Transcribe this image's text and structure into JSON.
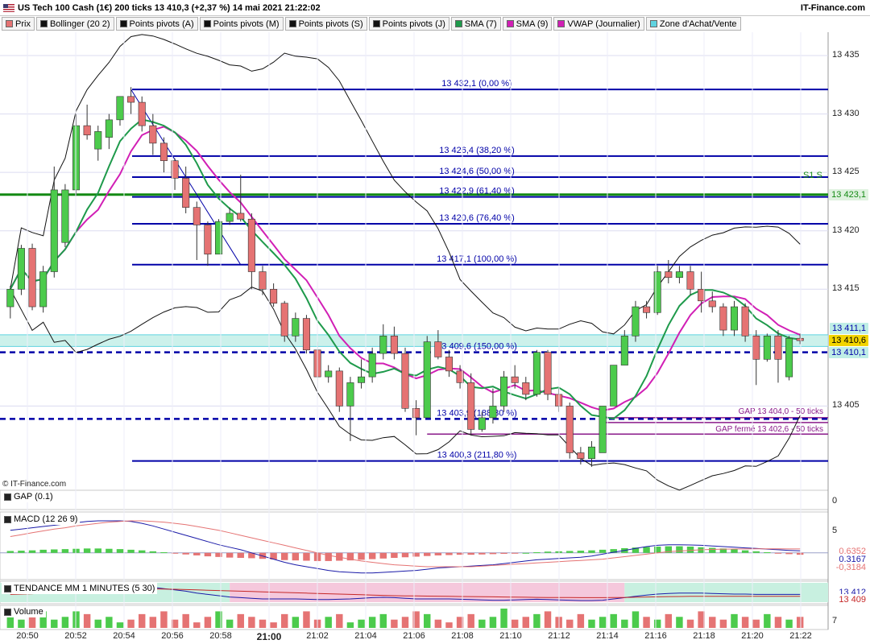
{
  "header": {
    "title": "US Tech 100 Cash (1€) 200 ticks 13 410,3 (+2,37 %) 14 mai 2021 21:22:02",
    "brand": "IT-Finance.com"
  },
  "legend": [
    {
      "label": "Prix",
      "color": "#e57373"
    },
    {
      "label": "Bollinger (20 2)",
      "color": "#111111"
    },
    {
      "label": "Points pivots (A)",
      "color": "#111111"
    },
    {
      "label": "Points pivots (M)",
      "color": "#111111"
    },
    {
      "label": "Points pivots (S)",
      "color": "#111111"
    },
    {
      "label": "Points pivots (J)",
      "color": "#111111"
    },
    {
      "label": "SMA (7)",
      "color": "#1e9a4b"
    },
    {
      "label": "SMA (9)",
      "color": "#d11fb5"
    },
    {
      "label": "VWAP (Journalier)",
      "color": "#d11fb5"
    },
    {
      "label": "Zone d'Achat/Vente",
      "color": "#5fd3e0"
    }
  ],
  "colors": {
    "up": "#4ccb4c",
    "down": "#e57373",
    "fib": "#0000a8",
    "pivot": "#138a13",
    "sma7": "#1e9a4b",
    "sma9": "#d11fb5",
    "bollinger": "#111111",
    "zone": "#bfeee6",
    "gap": "#8a1a8a",
    "panel_bg": "#ffffff",
    "grid": "#dcdcf0"
  },
  "price_axis": {
    "ticks": [
      "13 435",
      "13 430",
      "13 425",
      "13 420",
      "13 415",
      "13 405"
    ]
  },
  "price_tags": [
    {
      "text": "13 423,1",
      "bg": "#dff2df",
      "fg": "#138a13"
    },
    {
      "text": "13 411,1",
      "bg": "#bfeee6",
      "fg": "#0000a8"
    },
    {
      "text": "13 410,6",
      "bg": "#f2d400",
      "fg": "#000000"
    },
    {
      "text": "13 410,1",
      "bg": "#bfeee6",
      "fg": "#0000a8"
    }
  ],
  "annotations": {
    "copyright": "© IT-Finance.com",
    "s1": "S1 S",
    "gap_open": "GAP 13 404,0 - 50 ticks",
    "gap_closed": "GAP fermé 13 402,6 - 50 ticks"
  },
  "fib_levels": [
    {
      "price": 13432.1,
      "label": "13 432,1 (0,00 %)",
      "dashed": false
    },
    {
      "price": 13426.4,
      "label": "13 426,4 (38,20 %)",
      "dashed": false
    },
    {
      "price": 13424.6,
      "label": "13 424,6 (50,00 %)",
      "dashed": false
    },
    {
      "price": 13422.9,
      "label": "13 422,9 (61,40 %)",
      "dashed": false
    },
    {
      "price": 13420.6,
      "label": "13 420,6 (76,40 %)",
      "dashed": false
    },
    {
      "price": 13417.1,
      "label": "13 417,1 (100,00 %)",
      "dashed": false
    },
    {
      "price": 13409.6,
      "label": "13 409,6 (150,00 %)",
      "dashed": true
    },
    {
      "price": 13403.9,
      "label": "13 403,9 (188,30 %)",
      "dashed": true
    },
    {
      "price": 13400.3,
      "label": "13 400,3 (211,80 %)",
      "dashed": false
    }
  ],
  "panels": {
    "gap": {
      "label": "GAP (0.1)",
      "axis": "0"
    },
    "macd": {
      "label": "MACD (12 26 9)",
      "axis_top": "5",
      "tags": [
        {
          "text": "0,6352",
          "fg": "#e57373"
        },
        {
          "text": "0,3167",
          "fg": "#1a1aa8"
        },
        {
          "text": "-0,3184",
          "fg": "#e57373"
        }
      ]
    },
    "trend": {
      "label": "TENDANCE MM 1 MINUTES (5 30)",
      "tags": [
        {
          "text": "13 412",
          "fg": "#1a1aa8"
        },
        {
          "text": "13 409",
          "fg": "#c62828"
        }
      ]
    },
    "volume": {
      "label": "Volume",
      "axis": "7"
    }
  },
  "time_axis": {
    "labels": [
      {
        "text": "20:50",
        "bold": false
      },
      {
        "text": "20:52",
        "bold": false
      },
      {
        "text": "20:54",
        "bold": false
      },
      {
        "text": "20:56",
        "bold": false
      },
      {
        "text": "20:58",
        "bold": false
      },
      {
        "text": "21:00",
        "bold": true
      },
      {
        "text": "21:02",
        "bold": false
      },
      {
        "text": "21:04",
        "bold": false
      },
      {
        "text": "21:06",
        "bold": false
      },
      {
        "text": "21:08",
        "bold": false
      },
      {
        "text": "21:10",
        "bold": false
      },
      {
        "text": "21:12",
        "bold": false
      },
      {
        "text": "21:14",
        "bold": false
      },
      {
        "text": "21:16",
        "bold": false
      },
      {
        "text": "21:18",
        "bold": false
      },
      {
        "text": "21:20",
        "bold": false
      },
      {
        "text": "21:22",
        "bold": false
      }
    ]
  },
  "chart_data": {
    "type": "candlestick",
    "title": "US Tech 100 Cash (1€) 200 ticks",
    "ylim": [
      13398,
      13437
    ],
    "pivot_s1": 13423.1,
    "zone": [
      13410.1,
      13411.1
    ],
    "gap_open": 13404.0,
    "gap_closed": 13402.6,
    "candles": [
      {
        "o": 13413.5,
        "h": 13415.3,
        "l": 13412.5,
        "c": 13415.0
      },
      {
        "o": 13415.0,
        "h": 13418.8,
        "l": 13414.5,
        "c": 13418.5
      },
      {
        "o": 13418.5,
        "h": 13418.9,
        "l": 13413.2,
        "c": 13413.5
      },
      {
        "o": 13413.5,
        "h": 13417.0,
        "l": 13413.0,
        "c": 13416.5
      },
      {
        "o": 13416.5,
        "h": 13425.5,
        "l": 13416.0,
        "c": 13423.5
      },
      {
        "o": 13419.0,
        "h": 13424.0,
        "l": 13418.6,
        "c": 13423.5
      },
      {
        "o": 13423.5,
        "h": 13430.0,
        "l": 13423.0,
        "c": 13429.0
      },
      {
        "o": 13429.0,
        "h": 13430.8,
        "l": 13427.8,
        "c": 13428.2
      },
      {
        "o": 13427.0,
        "h": 13429.0,
        "l": 13426.0,
        "c": 13428.5
      },
      {
        "o": 13428.0,
        "h": 13430.0,
        "l": 13427.0,
        "c": 13429.5
      },
      {
        "o": 13429.5,
        "h": 13431.5,
        "l": 13429.0,
        "c": 13431.5
      },
      {
        "o": 13431.5,
        "h": 13432.3,
        "l": 13430.0,
        "c": 13431.0
      },
      {
        "o": 13431.0,
        "h": 13431.5,
        "l": 13428.5,
        "c": 13429.0
      },
      {
        "o": 13429.0,
        "h": 13430.0,
        "l": 13426.5,
        "c": 13427.5
      },
      {
        "o": 13427.5,
        "h": 13428.0,
        "l": 13425.0,
        "c": 13426.0
      },
      {
        "o": 13426.0,
        "h": 13426.2,
        "l": 13423.5,
        "c": 13424.5
      },
      {
        "o": 13424.5,
        "h": 13425.5,
        "l": 13421.5,
        "c": 13422.0
      },
      {
        "o": 13422.0,
        "h": 13422.5,
        "l": 13417.5,
        "c": 13420.5
      },
      {
        "o": 13420.5,
        "h": 13420.8,
        "l": 13417.0,
        "c": 13418.0
      },
      {
        "o": 13418.0,
        "h": 13421.0,
        "l": 13418.0,
        "c": 13420.8
      },
      {
        "o": 13420.8,
        "h": 13422.0,
        "l": 13420.5,
        "c": 13421.5
      },
      {
        "o": 13421.5,
        "h": 13424.8,
        "l": 13420.8,
        "c": 13421.0
      },
      {
        "o": 13421.0,
        "h": 13421.5,
        "l": 13415.0,
        "c": 13416.5
      },
      {
        "o": 13416.5,
        "h": 13417.0,
        "l": 13414.5,
        "c": 13415.0
      },
      {
        "o": 13415.0,
        "h": 13415.5,
        "l": 13413.5,
        "c": 13413.8
      },
      {
        "o": 13413.8,
        "h": 13414.0,
        "l": 13410.5,
        "c": 13411.0
      },
      {
        "o": 13411.0,
        "h": 13413.0,
        "l": 13410.5,
        "c": 13412.5
      },
      {
        "o": 13412.5,
        "h": 13412.8,
        "l": 13409.5,
        "c": 13409.8
      },
      {
        "o": 13409.8,
        "h": 13410.5,
        "l": 13406.5,
        "c": 13407.5
      },
      {
        "o": 13407.5,
        "h": 13408.5,
        "l": 13407.0,
        "c": 13408.0
      },
      {
        "o": 13408.0,
        "h": 13408.3,
        "l": 13404.5,
        "c": 13405.0
      },
      {
        "o": 13405.0,
        "h": 13407.5,
        "l": 13402.0,
        "c": 13407.0
      },
      {
        "o": 13407.0,
        "h": 13409.0,
        "l": 13406.5,
        "c": 13407.5
      },
      {
        "o": 13407.5,
        "h": 13410.0,
        "l": 13407.0,
        "c": 13409.5
      },
      {
        "o": 13409.5,
        "h": 13412.0,
        "l": 13409.0,
        "c": 13411.0
      },
      {
        "o": 13411.0,
        "h": 13411.8,
        "l": 13409.0,
        "c": 13409.5
      },
      {
        "o": 13409.5,
        "h": 13410.0,
        "l": 13404.5,
        "c": 13404.8
      },
      {
        "o": 13404.8,
        "h": 13405.5,
        "l": 13402.5,
        "c": 13404.0
      },
      {
        "o": 13404.0,
        "h": 13411.0,
        "l": 13404.0,
        "c": 13410.5
      },
      {
        "o": 13410.5,
        "h": 13411.5,
        "l": 13409.0,
        "c": 13409.2
      },
      {
        "o": 13409.2,
        "h": 13409.8,
        "l": 13407.5,
        "c": 13408.0
      },
      {
        "o": 13408.0,
        "h": 13408.5,
        "l": 13406.5,
        "c": 13407.0
      },
      {
        "o": 13407.0,
        "h": 13407.8,
        "l": 13402.5,
        "c": 13403.0
      },
      {
        "o": 13403.0,
        "h": 13404.5,
        "l": 13402.8,
        "c": 13404.0
      },
      {
        "o": 13404.0,
        "h": 13406.5,
        "l": 13403.5,
        "c": 13405.0
      },
      {
        "o": 13405.0,
        "h": 13408.0,
        "l": 13404.5,
        "c": 13407.5
      },
      {
        "o": 13407.5,
        "h": 13408.5,
        "l": 13406.5,
        "c": 13407.0
      },
      {
        "o": 13407.0,
        "h": 13407.5,
        "l": 13405.5,
        "c": 13406.0
      },
      {
        "o": 13406.0,
        "h": 13409.8,
        "l": 13405.8,
        "c": 13409.6
      },
      {
        "o": 13409.6,
        "h": 13409.8,
        "l": 13405.5,
        "c": 13406.0
      },
      {
        "o": 13406.0,
        "h": 13406.5,
        "l": 13404.5,
        "c": 13405.0
      },
      {
        "o": 13405.0,
        "h": 13405.3,
        "l": 13400.5,
        "c": 13401.0
      },
      {
        "o": 13401.0,
        "h": 13401.5,
        "l": 13400.0,
        "c": 13400.5
      },
      {
        "o": 13400.5,
        "h": 13402.0,
        "l": 13399.8,
        "c": 13401.5
      },
      {
        "o": 13401.0,
        "h": 13405.0,
        "l": 13401.0,
        "c": 13405.0
      },
      {
        "o": 13405.0,
        "h": 13408.5,
        "l": 13405.0,
        "c": 13408.5
      },
      {
        "o": 13408.5,
        "h": 13411.5,
        "l": 13408.5,
        "c": 13411.0
      },
      {
        "o": 13411.0,
        "h": 13414.0,
        "l": 13410.5,
        "c": 13413.5
      },
      {
        "o": 13413.5,
        "h": 13414.0,
        "l": 13412.5,
        "c": 13413.0
      },
      {
        "o": 13413.0,
        "h": 13417.0,
        "l": 13412.8,
        "c": 13416.5
      },
      {
        "o": 13416.5,
        "h": 13417.5,
        "l": 13415.5,
        "c": 13416.0
      },
      {
        "o": 13416.0,
        "h": 13417.0,
        "l": 13415.5,
        "c": 13416.5
      },
      {
        "o": 13416.5,
        "h": 13417.0,
        "l": 13414.5,
        "c": 13415.0
      },
      {
        "o": 13415.0,
        "h": 13416.5,
        "l": 13413.0,
        "c": 13414.0
      },
      {
        "o": 13414.0,
        "h": 13414.8,
        "l": 13413.0,
        "c": 13413.5
      },
      {
        "o": 13413.5,
        "h": 13413.8,
        "l": 13411.0,
        "c": 13411.5
      },
      {
        "o": 13411.5,
        "h": 13414.0,
        "l": 13411.0,
        "c": 13413.5
      },
      {
        "o": 13413.5,
        "h": 13413.8,
        "l": 13410.5,
        "c": 13411.0
      },
      {
        "o": 13411.0,
        "h": 13411.5,
        "l": 13406.8,
        "c": 13409.0
      },
      {
        "o": 13409.0,
        "h": 13411.2,
        "l": 13408.8,
        "c": 13411.0
      },
      {
        "o": 13411.0,
        "h": 13411.5,
        "l": 13407.0,
        "c": 13409.0
      },
      {
        "o": 13407.5,
        "h": 13411.0,
        "l": 13407.2,
        "c": 13410.8
      },
      {
        "o": 13410.8,
        "h": 13411.2,
        "l": 13410.3,
        "c": 13410.6
      }
    ],
    "macd_hist": [
      0.3,
      0.35,
      0.4,
      0.5,
      0.55,
      0.6,
      0.65,
      0.7,
      0.7,
      0.65,
      0.6,
      0.5,
      0.4,
      0.25,
      0.1,
      -0.1,
      -0.25,
      -0.4,
      -0.55,
      -0.65,
      -0.75,
      -0.8,
      -0.85,
      -0.95,
      -1.05,
      -1.15,
      -1.2,
      -1.25,
      -1.3,
      -1.3,
      -1.25,
      -1.2,
      -1.1,
      -1.0,
      -0.9,
      -0.8,
      -0.7,
      -0.6,
      -0.5,
      -0.4,
      -0.35,
      -0.3,
      -0.3,
      -0.25,
      -0.2,
      -0.15,
      -0.1,
      0.0,
      0.1,
      0.2,
      0.25,
      0.3,
      0.35,
      0.4,
      0.5,
      0.6,
      0.75,
      0.85,
      0.95,
      1.0,
      1.05,
      1.05,
      1.0,
      0.9,
      0.8,
      0.7,
      0.55,
      0.4,
      0.25,
      0.1,
      -0.1,
      -0.2,
      -0.3
    ],
    "macd_line": [
      3.6,
      3.8,
      4.0,
      4.2,
      4.4,
      4.6,
      4.8,
      5.0,
      5.1,
      5.1,
      5.1,
      5.0,
      4.7,
      4.3,
      3.8,
      3.3,
      2.8,
      2.3,
      1.8,
      1.3,
      0.9,
      0.5,
      0.0,
      -0.5,
      -1.0,
      -1.5,
      -1.9,
      -2.2,
      -2.5,
      -2.8,
      -3.0,
      -3.1,
      -3.2,
      -3.2,
      -3.1,
      -3.0,
      -2.9,
      -2.8,
      -2.6,
      -2.4,
      -2.3,
      -2.2,
      -2.1,
      -2.0,
      -1.9,
      -1.7,
      -1.5,
      -1.3,
      -1.1,
      -1.0,
      -0.9,
      -0.8,
      -0.7,
      -0.5,
      -0.2,
      0.1,
      0.4,
      0.7,
      1.0,
      1.2,
      1.3,
      1.3,
      1.25,
      1.2,
      1.1,
      1.0,
      0.9,
      0.8,
      0.7,
      0.6,
      0.5,
      0.4,
      0.32
    ],
    "macd_signal": [
      2.6,
      2.9,
      3.2,
      3.5,
      3.8,
      4.0,
      4.3,
      4.5,
      4.7,
      4.9,
      5.0,
      5.1,
      5.1,
      5.0,
      4.9,
      4.7,
      4.5,
      4.2,
      3.9,
      3.6,
      3.2,
      2.8,
      2.4,
      2.0,
      1.6,
      1.2,
      0.8,
      0.4,
      0.0,
      -0.4,
      -0.7,
      -1.0,
      -1.3,
      -1.5,
      -1.7,
      -1.9,
      -2.0,
      -2.1,
      -2.2,
      -2.2,
      -2.2,
      -2.2,
      -2.2,
      -2.1,
      -2.0,
      -1.9,
      -1.8,
      -1.7,
      -1.6,
      -1.5,
      -1.4,
      -1.3,
      -1.2,
      -1.1,
      -1.0,
      -0.8,
      -0.6,
      -0.4,
      -0.2,
      0.0,
      0.2,
      0.3,
      0.4,
      0.5,
      0.55,
      0.6,
      0.62,
      0.63,
      0.64,
      0.64,
      0.64,
      0.63,
      0.63
    ],
    "trend_fast": [
      13416,
      13417,
      13418,
      13420,
      13422,
      13424,
      13426,
      13427,
      13428,
      13428.5,
      13428,
      13427,
      13425,
      13423,
      13421,
      13419,
      13417,
      13414,
      13412,
      13410,
      13408,
      13407,
      13406,
      13405,
      13405,
      13405,
      13405,
      13404.5,
      13404,
      13404,
      13404.5,
      13405,
      13406,
      13407,
      13407.5,
      13407,
      13406,
      13405,
      13405,
      13405,
      13405,
      13404.5,
      13404,
      13403.5,
      13403,
      13403,
      13403.5,
      13404,
      13404.5,
      13404,
      13403.5,
      13403,
      13402.5,
      13402.5,
      13403,
      13405,
      13407,
      13409,
      13411,
      13412.5,
      13413.5,
      13414,
      13414,
      13414,
      13413.5,
      13413,
      13412.5,
      13412.5,
      13412,
      13412,
      13412,
      13412,
      13412
    ],
    "trend_slow": [
      13412,
      13412.5,
      13413,
      13414,
      13415,
      13416,
      13417,
      13418,
      13419,
      13419.5,
      13420,
      13420.3,
      13420.5,
      13420.5,
      13420.3,
      13420,
      13419.5,
      13419,
      13418.5,
      13418,
      13417.5,
      13417,
      13416.5,
      13416,
      13415.5,
      13415,
      13414.5,
      13414,
      13413.5,
      13413,
      13412.5,
      13412,
      13411.5,
      13411,
      13410.5,
      13410,
      13409.8,
      13409.6,
      13409.4,
      13409.2,
      13409,
      13408.8,
      13408.6,
      13408.4,
      13408.2,
      13408,
      13407.8,
      13407.6,
      13407.4,
      13407.3,
      13407.2,
      13407.1,
      13407,
      13407,
      13407,
      13407.1,
      13407.3,
      13407.6,
      13408,
      13408.3,
      13408.6,
      13408.8,
      13409,
      13409,
      13409,
      13409,
      13409,
      13409,
      13409,
      13409,
      13409,
      13409,
      13409
    ],
    "volume": [
      4,
      3,
      5,
      6,
      3,
      4,
      6,
      5,
      3,
      4,
      2,
      3,
      5,
      4,
      6,
      3,
      5,
      2,
      4,
      6,
      3,
      5,
      4,
      3,
      2,
      5,
      4,
      6,
      3,
      4,
      5,
      2,
      3,
      4,
      5,
      3,
      4,
      6,
      5,
      3,
      2,
      4,
      5,
      3,
      4,
      7,
      3,
      4,
      5,
      6,
      4,
      3,
      5,
      3,
      4,
      5,
      3,
      6,
      4,
      3,
      5,
      4,
      3,
      6,
      4,
      3,
      5,
      4,
      3,
      5,
      4,
      3,
      4
    ]
  }
}
